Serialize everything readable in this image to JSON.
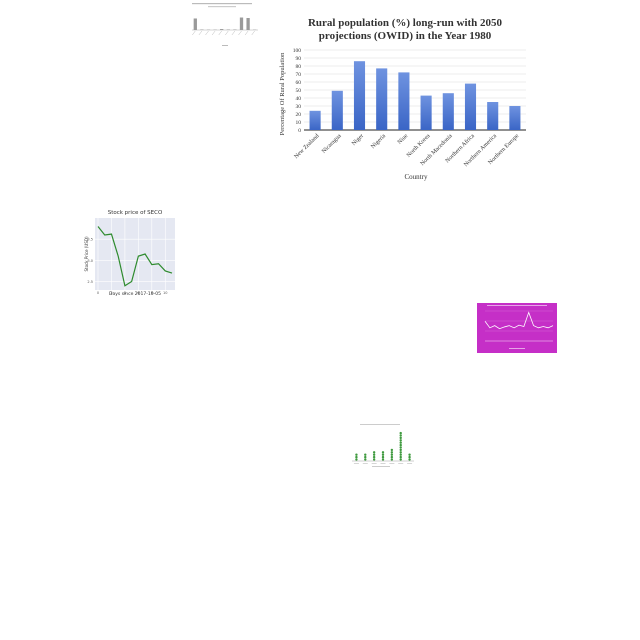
{
  "colors": {
    "main_bar": "#3a65c6",
    "main_bar_top": "#6f93e0",
    "stock_line": "#2e8b2e",
    "stock_bg": "#e5e8f2",
    "thumb1_bar": "#9a9a9a",
    "magenta_bg": "#c52fc7",
    "green_dot": "#3f9a3f"
  },
  "chart_data": [
    {
      "type": "bar",
      "title": "Rural population (%) long-run with 2050 projections (OWID) in the Year 1980",
      "xlabel": "Country",
      "ylabel": "Percentage Of Rural Population",
      "categories": [
        "New Zealand",
        "Nicaragua",
        "Niger",
        "Nigeria",
        "Niue",
        "North Korea",
        "North Macedonia",
        "Northern Africa",
        "Northern America",
        "Northern Europe"
      ],
      "values": [
        24,
        49,
        86,
        77,
        72,
        43,
        46,
        58,
        35,
        30
      ],
      "ylim": [
        0,
        100
      ],
      "yticks": [
        "0",
        "10",
        "20",
        "30",
        "40",
        "50",
        "60",
        "70",
        "80",
        "90",
        "100"
      ],
      "grid": true,
      "legend": "none"
    },
    {
      "type": "line",
      "title": "Stock price of SECO",
      "xlabel": "Days since 2017-10-05",
      "ylabel": "Stock Price (USD)",
      "x": [
        0,
        1,
        2,
        3,
        4,
        5,
        6,
        7,
        8,
        9,
        10,
        11
      ],
      "values": [
        3.8,
        3.6,
        3.62,
        3.1,
        2.4,
        2.5,
        3.1,
        3.15,
        2.9,
        2.92,
        2.75,
        2.7
      ],
      "ylim": [
        2.3,
        4.0
      ],
      "grid": true,
      "legend": "none"
    },
    {
      "type": "bar",
      "title": "",
      "values": [
        72,
        3,
        2,
        2,
        6,
        3,
        3,
        78,
        75,
        2
      ],
      "ylim": [
        0,
        100
      ],
      "legend": "none"
    },
    {
      "type": "line",
      "title": "",
      "values": [
        45,
        30,
        35,
        28,
        32,
        35,
        30,
        36,
        33,
        65,
        35,
        30,
        33,
        30,
        35
      ],
      "legend": "none"
    },
    {
      "type": "scatter",
      "title": "",
      "values": [
        3,
        3,
        4,
        4,
        5,
        12,
        3
      ],
      "legend": "none"
    }
  ]
}
